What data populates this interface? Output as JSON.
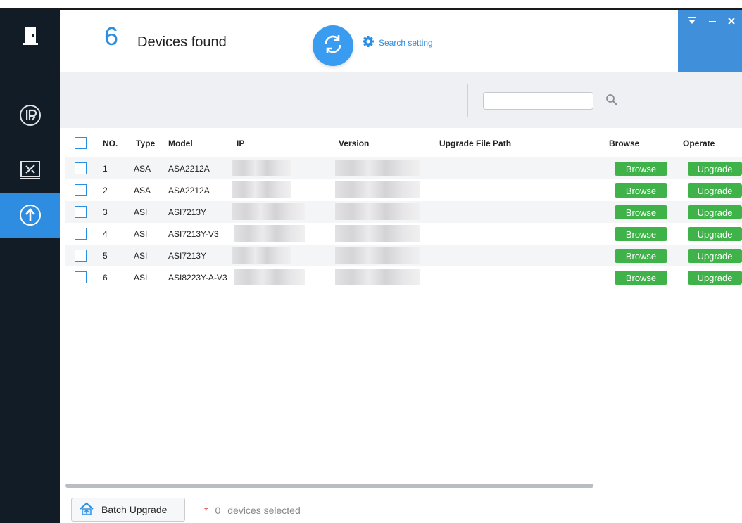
{
  "header": {
    "device_count": "6",
    "found_label": "Devices found",
    "search_setting_label": "Search setting"
  },
  "window_controls": [
    "menu-icon",
    "minimize-icon",
    "close-icon"
  ],
  "sidebar": {
    "items": [
      {
        "icon": "door-icon",
        "active": false
      },
      {
        "icon": "ip-icon",
        "active": false
      },
      {
        "icon": "tools-icon",
        "active": false
      },
      {
        "icon": "upgrade-icon",
        "active": true
      }
    ]
  },
  "search": {
    "value": "",
    "placeholder": ""
  },
  "table": {
    "headers": {
      "no": "NO.",
      "type": "Type",
      "model": "Model",
      "ip": "IP",
      "version": "Version",
      "path": "Upgrade File Path",
      "browse": "Browse",
      "operate": "Operate"
    },
    "rows": [
      {
        "no": "1",
        "type": "ASA",
        "model": "ASA2212A",
        "browse": "Browse",
        "operate": "Upgrade"
      },
      {
        "no": "2",
        "type": "ASA",
        "model": "ASA2212A",
        "browse": "Browse",
        "operate": "Upgrade"
      },
      {
        "no": "3",
        "type": "ASI",
        "model": "ASI7213Y",
        "browse": "Browse",
        "operate": "Upgrade"
      },
      {
        "no": "4",
        "type": "ASI",
        "model": "ASI7213Y-V3",
        "browse": "Browse",
        "operate": "Upgrade"
      },
      {
        "no": "5",
        "type": "ASI",
        "model": "ASI7213Y",
        "browse": "Browse",
        "operate": "Upgrade"
      },
      {
        "no": "6",
        "type": "ASI",
        "model": "ASI8223Y-A-V3",
        "browse": "Browse",
        "operate": "Upgrade"
      }
    ]
  },
  "footer": {
    "batch_label": "Batch Upgrade",
    "star": "*",
    "selected_count": "0",
    "selected_label": "devices selected"
  },
  "colors": {
    "accent": "#2a8ee3",
    "sidebar": "#111c26",
    "green": "#3fb34a",
    "toolbar": "#eef0f3"
  }
}
